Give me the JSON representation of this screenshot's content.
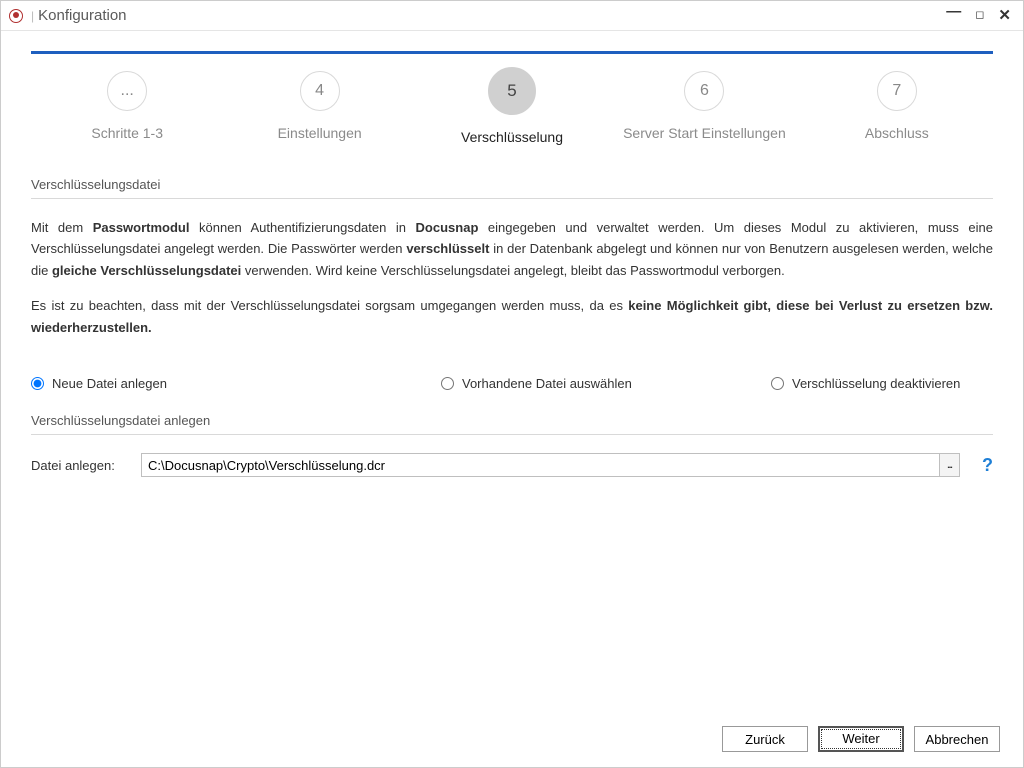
{
  "window": {
    "title": "Konfiguration"
  },
  "steps": [
    {
      "num": "...",
      "label": "Schritte 1-3",
      "active": false
    },
    {
      "num": "4",
      "label": "Einstellungen",
      "active": false
    },
    {
      "num": "5",
      "label": "Verschlüsselung",
      "active": true
    },
    {
      "num": "6",
      "label": "Server Start Einstellungen",
      "active": false
    },
    {
      "num": "7",
      "label": "Abschluss",
      "active": false
    }
  ],
  "section1_title": "Verschlüsselungsdatei",
  "desc": {
    "p1_a": "Mit dem ",
    "p1_b": "Passwortmodul",
    "p1_c": " können Authentifizierungsdaten in ",
    "p1_d": "Docusnap",
    "p1_e": " eingegeben und verwaltet werden. Um dieses Modul zu aktivieren, muss eine Verschlüsselungsdatei angelegt werden. Die Passwörter werden ",
    "p1_f": "verschlüsselt",
    "p1_g": " in der Datenbank abgelegt und können nur von Benutzern ausgelesen werden, welche die ",
    "p1_h": "gleiche Verschlüsselungsdatei",
    "p1_i": " verwenden. Wird keine Verschlüsselungsdatei angelegt, bleibt das Passwortmodul verborgen.",
    "p2_a": "Es ist zu beachten, dass mit der Verschlüsselungsdatei sorgsam umgegangen werden muss, da es ",
    "p2_b": "keine Möglichkeit gibt, diese bei Verlust zu ersetzen bzw. wiederherzustellen."
  },
  "radios": {
    "opt1": "Neue Datei anlegen",
    "opt2": "Vorhandene Datei auswählen",
    "opt3": "Verschlüsselung deaktivieren",
    "selected": "opt1"
  },
  "section2_title": "Verschlüsselungsdatei anlegen",
  "file": {
    "label": "Datei anlegen:",
    "path": "C:\\Docusnap\\Crypto\\Verschlüsselung.dcr",
    "browse": "..."
  },
  "help": "?",
  "buttons": {
    "back": "Zurück",
    "next": "Weiter",
    "cancel": "Abbrechen"
  }
}
